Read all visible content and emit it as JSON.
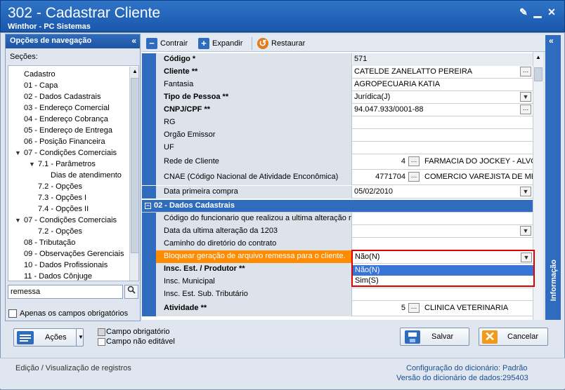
{
  "window": {
    "title": "302 - Cadastrar Cliente",
    "subtitle": "Winthor - PC Sistemas"
  },
  "left_panel": {
    "header": "Opções de navegação",
    "sections_label": "Seções:",
    "tree": [
      {
        "label": "Cadastro"
      },
      {
        "label": "01 - Capa"
      },
      {
        "label": "02 - Dados Cadastrais"
      },
      {
        "label": "03 - Endereço Comercial"
      },
      {
        "label": "04 - Endereço Cobrança"
      },
      {
        "label": "05 - Endereço de Entrega"
      },
      {
        "label": "06 - Posição Financeira"
      },
      {
        "label": "07 - Condições Comerciais"
      },
      {
        "label": "7.1 - Parâmetros"
      },
      {
        "label": "Dias de atendimento"
      },
      {
        "label": "7.2 - Opções"
      },
      {
        "label": "7.3 - Opções I"
      },
      {
        "label": "7.4 - Opções II"
      },
      {
        "label": "07 - Condições Comerciais"
      },
      {
        "label": "7.2 - Opções"
      },
      {
        "label": "08 - Tributação"
      },
      {
        "label": "09 - Observações Gerenciais"
      },
      {
        "label": "10 - Dados Profissionais"
      },
      {
        "label": "11 - Dados Cônjuge"
      }
    ],
    "search_value": "remessa",
    "required_only_label": "Apenas os campos obrigatórios"
  },
  "toolbar": {
    "collapse": "Contrair",
    "expand": "Expandir",
    "restore": "Restaurar"
  },
  "grid": {
    "rows": [
      {
        "name": "Código *",
        "value": "571"
      },
      {
        "name": "Cliente **",
        "value": "CATELDE ZANELATTO PEREIRA"
      },
      {
        "name": "Fantasia",
        "value": "AGROPECUARIA KATIA"
      },
      {
        "name": "Tipo de Pessoa **",
        "value": "Jurídica(J)"
      },
      {
        "name": "CNPJ/CPF **",
        "value": "94.047.933/0001-88"
      },
      {
        "name": "RG",
        "value": ""
      },
      {
        "name": "Orgão Emissor",
        "value": ""
      },
      {
        "name": "UF",
        "value": ""
      },
      {
        "name": "Rede de Cliente",
        "value": "4",
        "value2": "FARMACIA DO JOCKEY - ALVOR"
      },
      {
        "name": "CNAE (Código Nacional de Atividade Enconômica)",
        "value": "4771704",
        "value2": "COMERCIO VAREJISTA DE MED"
      },
      {
        "name": "Data primeira compra",
        "value": "05/02/2010"
      }
    ],
    "category": "02 - Dados Cadastrais",
    "rows2": [
      {
        "name": "Código do funcionario que realizou a ultima alteração na",
        "value": ""
      },
      {
        "name": "Data da ultima alteração da 1203",
        "value": ""
      },
      {
        "name": "Caminho do diretório do contrato",
        "value": ""
      },
      {
        "name": "Bloquear geração de arquivo remessa para o cliente.",
        "value": "Não(N)"
      },
      {
        "name": "Insc. Est. / Produtor **",
        "value": ""
      },
      {
        "name": "Insc. Municipal",
        "value": ""
      },
      {
        "name": "Insc. Est. Sub. Tributário",
        "value": ""
      },
      {
        "name": "Atividade **",
        "value": "5",
        "value2": "CLINICA VETERINARIA"
      }
    ],
    "dropdown_options": [
      "Não(N)",
      "Sim(S)"
    ]
  },
  "side_tab": "Informação",
  "buttons": {
    "actions": "Ações",
    "save": "Salvar",
    "cancel": "Cancelar"
  },
  "legend": {
    "required": "Campo obrigatório",
    "readonly": "Campo não editável"
  },
  "status": {
    "left": "Edição / Visualização de registros",
    "config_label": "Configuração do dicionário:",
    "config_value": "Padrão",
    "version_label": "Versão do dicionário de dados:",
    "version_value": "295403"
  },
  "colors": {
    "accent": "#2f6cbd",
    "highlight": "#ff8c00",
    "selection": "#3875d7",
    "border_red": "#e00000"
  }
}
